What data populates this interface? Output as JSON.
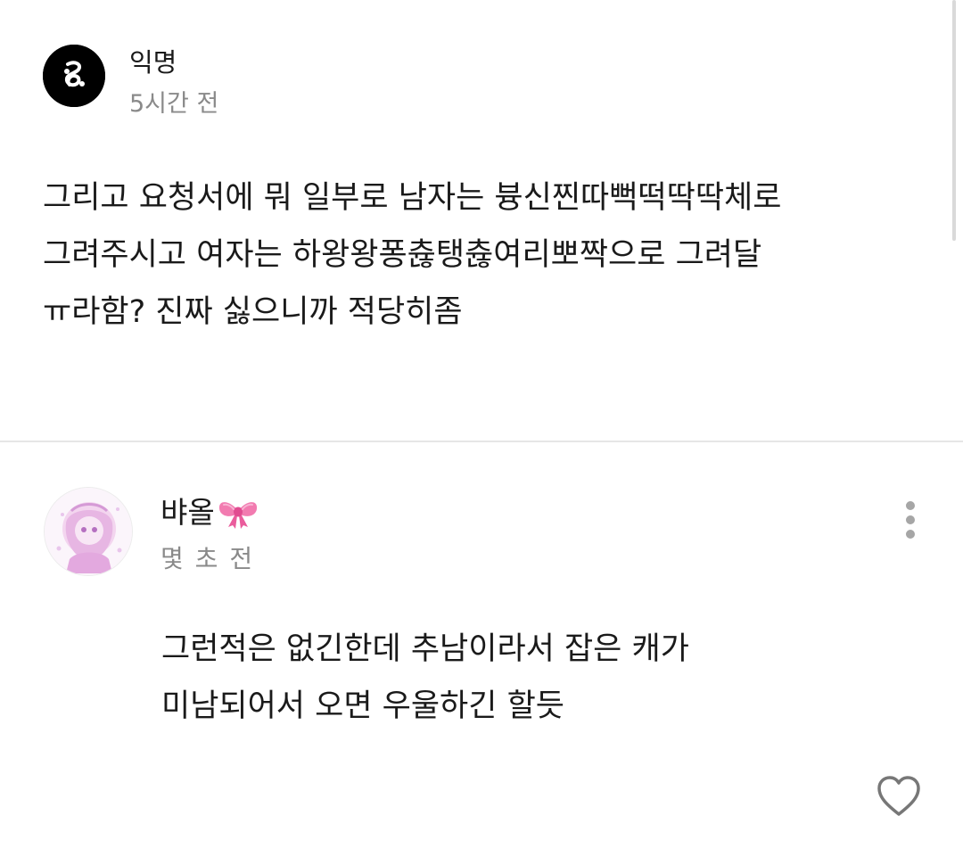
{
  "post": {
    "author": "익명",
    "time": "5시간 전",
    "body_lines": [
      "그리고 요청서에 뭐 일부로 남자는 븅신찐따뻑떡딱딱체로",
      "그려주시고 여자는 하왕왕퐁츊탱츊여리뽀짝으로 그려달",
      "ㅠ라함? 진짜 싫으니까 적당히좀"
    ]
  },
  "comment": {
    "author": "뱌올",
    "author_emoji": "ribbon-bow-icon",
    "time": "몇 초 전",
    "body_lines": [
      "그런적은 없긴한데 추남이라서 잡은 캐가",
      "미남되어서 오면 우울하긴 할듯"
    ]
  },
  "icons": {
    "post_avatar": "anonymous-avatar-icon",
    "more": "more-vertical-icon",
    "like": "heart-outline-icon"
  },
  "colors": {
    "text": "#1a1a1a",
    "meta": "#8a8a8a",
    "divider": "#e6e6e6",
    "bow": "#f06fa6"
  }
}
